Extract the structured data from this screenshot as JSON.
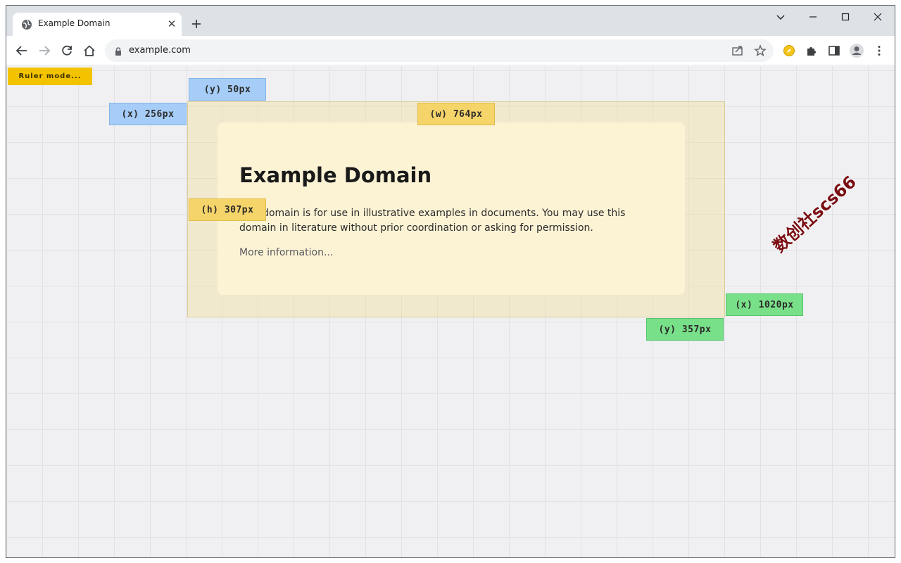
{
  "browser": {
    "tab": {
      "title": "Example Domain",
      "favicon": "globe-icon"
    },
    "url": "example.com",
    "icons": {
      "back": "arrow-left-icon",
      "forward": "arrow-right-icon",
      "reload": "reload-icon",
      "home": "home-icon",
      "share": "share-icon",
      "bookmark": "star-icon",
      "extension": "compass-icon",
      "extensions": "puzzle-icon",
      "sidepanel": "side-panel-icon",
      "profile": "avatar-icon",
      "menu": "kebab-menu-icon"
    }
  },
  "ruler": {
    "mode_label": "Ruler mode...",
    "labels": {
      "top_y": "(y) 50px",
      "left_x": "(x) 256px",
      "width": "(w) 764px",
      "height": "(h) 307px",
      "right_x": "(x) 1020px",
      "bottom_y": "(y) 357px"
    }
  },
  "page": {
    "heading": "Example Domain",
    "description": "This domain is for use in illustrative examples in documents. You may use this domain in literature without prior coordination or asking for permission.",
    "link": "More information..."
  },
  "watermark": "数创社scs66",
  "colors": {
    "ruler_yellow": "#f3c300",
    "tag_blue": "#a6cdf7",
    "tag_yellow": "#f5d46a",
    "tag_green": "#79e08a",
    "watermark": "#7a0d12"
  }
}
